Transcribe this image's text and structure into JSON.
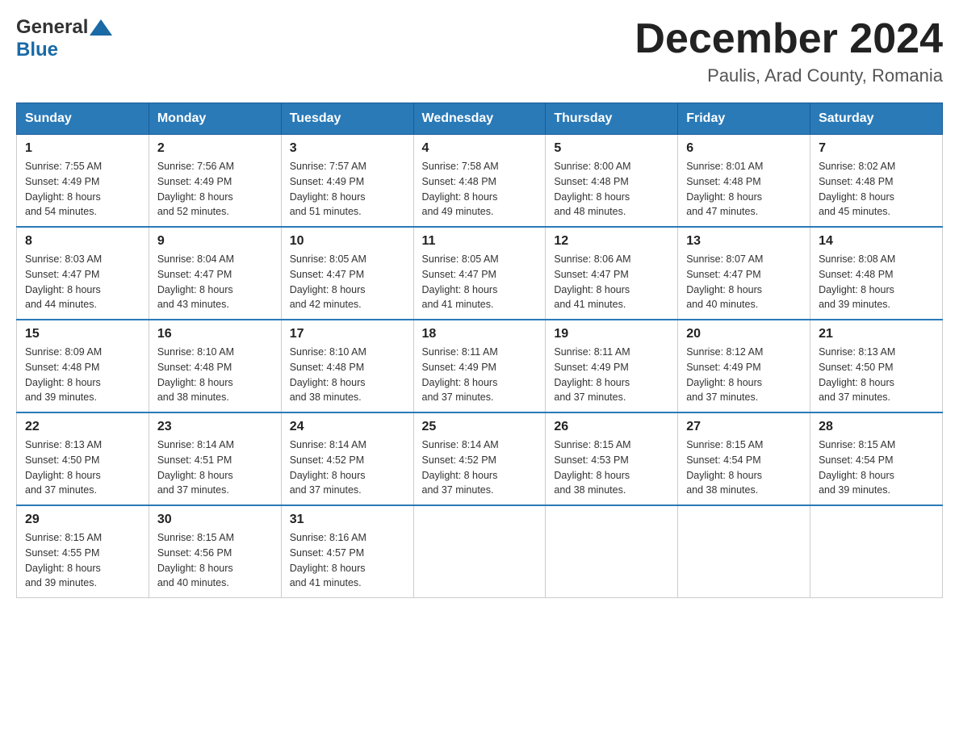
{
  "header": {
    "title": "December 2024",
    "subtitle": "Paulis, Arad County, Romania",
    "logo_general": "General",
    "logo_blue": "Blue"
  },
  "days_of_week": [
    "Sunday",
    "Monday",
    "Tuesday",
    "Wednesday",
    "Thursday",
    "Friday",
    "Saturday"
  ],
  "weeks": [
    {
      "days": [
        {
          "num": "1",
          "sunrise": "7:55 AM",
          "sunset": "4:49 PM",
          "daylight": "8 hours and 54 minutes."
        },
        {
          "num": "2",
          "sunrise": "7:56 AM",
          "sunset": "4:49 PM",
          "daylight": "8 hours and 52 minutes."
        },
        {
          "num": "3",
          "sunrise": "7:57 AM",
          "sunset": "4:49 PM",
          "daylight": "8 hours and 51 minutes."
        },
        {
          "num": "4",
          "sunrise": "7:58 AM",
          "sunset": "4:48 PM",
          "daylight": "8 hours and 49 minutes."
        },
        {
          "num": "5",
          "sunrise": "8:00 AM",
          "sunset": "4:48 PM",
          "daylight": "8 hours and 48 minutes."
        },
        {
          "num": "6",
          "sunrise": "8:01 AM",
          "sunset": "4:48 PM",
          "daylight": "8 hours and 47 minutes."
        },
        {
          "num": "7",
          "sunrise": "8:02 AM",
          "sunset": "4:48 PM",
          "daylight": "8 hours and 45 minutes."
        }
      ]
    },
    {
      "days": [
        {
          "num": "8",
          "sunrise": "8:03 AM",
          "sunset": "4:47 PM",
          "daylight": "8 hours and 44 minutes."
        },
        {
          "num": "9",
          "sunrise": "8:04 AM",
          "sunset": "4:47 PM",
          "daylight": "8 hours and 43 minutes."
        },
        {
          "num": "10",
          "sunrise": "8:05 AM",
          "sunset": "4:47 PM",
          "daylight": "8 hours and 42 minutes."
        },
        {
          "num": "11",
          "sunrise": "8:05 AM",
          "sunset": "4:47 PM",
          "daylight": "8 hours and 41 minutes."
        },
        {
          "num": "12",
          "sunrise": "8:06 AM",
          "sunset": "4:47 PM",
          "daylight": "8 hours and 41 minutes."
        },
        {
          "num": "13",
          "sunrise": "8:07 AM",
          "sunset": "4:47 PM",
          "daylight": "8 hours and 40 minutes."
        },
        {
          "num": "14",
          "sunrise": "8:08 AM",
          "sunset": "4:48 PM",
          "daylight": "8 hours and 39 minutes."
        }
      ]
    },
    {
      "days": [
        {
          "num": "15",
          "sunrise": "8:09 AM",
          "sunset": "4:48 PM",
          "daylight": "8 hours and 39 minutes."
        },
        {
          "num": "16",
          "sunrise": "8:10 AM",
          "sunset": "4:48 PM",
          "daylight": "8 hours and 38 minutes."
        },
        {
          "num": "17",
          "sunrise": "8:10 AM",
          "sunset": "4:48 PM",
          "daylight": "8 hours and 38 minutes."
        },
        {
          "num": "18",
          "sunrise": "8:11 AM",
          "sunset": "4:49 PM",
          "daylight": "8 hours and 37 minutes."
        },
        {
          "num": "19",
          "sunrise": "8:11 AM",
          "sunset": "4:49 PM",
          "daylight": "8 hours and 37 minutes."
        },
        {
          "num": "20",
          "sunrise": "8:12 AM",
          "sunset": "4:49 PM",
          "daylight": "8 hours and 37 minutes."
        },
        {
          "num": "21",
          "sunrise": "8:13 AM",
          "sunset": "4:50 PM",
          "daylight": "8 hours and 37 minutes."
        }
      ]
    },
    {
      "days": [
        {
          "num": "22",
          "sunrise": "8:13 AM",
          "sunset": "4:50 PM",
          "daylight": "8 hours and 37 minutes."
        },
        {
          "num": "23",
          "sunrise": "8:14 AM",
          "sunset": "4:51 PM",
          "daylight": "8 hours and 37 minutes."
        },
        {
          "num": "24",
          "sunrise": "8:14 AM",
          "sunset": "4:52 PM",
          "daylight": "8 hours and 37 minutes."
        },
        {
          "num": "25",
          "sunrise": "8:14 AM",
          "sunset": "4:52 PM",
          "daylight": "8 hours and 37 minutes."
        },
        {
          "num": "26",
          "sunrise": "8:15 AM",
          "sunset": "4:53 PM",
          "daylight": "8 hours and 38 minutes."
        },
        {
          "num": "27",
          "sunrise": "8:15 AM",
          "sunset": "4:54 PM",
          "daylight": "8 hours and 38 minutes."
        },
        {
          "num": "28",
          "sunrise": "8:15 AM",
          "sunset": "4:54 PM",
          "daylight": "8 hours and 39 minutes."
        }
      ]
    },
    {
      "days": [
        {
          "num": "29",
          "sunrise": "8:15 AM",
          "sunset": "4:55 PM",
          "daylight": "8 hours and 39 minutes."
        },
        {
          "num": "30",
          "sunrise": "8:15 AM",
          "sunset": "4:56 PM",
          "daylight": "8 hours and 40 minutes."
        },
        {
          "num": "31",
          "sunrise": "8:16 AM",
          "sunset": "4:57 PM",
          "daylight": "8 hours and 41 minutes."
        },
        null,
        null,
        null,
        null
      ]
    }
  ],
  "labels": {
    "sunrise": "Sunrise:",
    "sunset": "Sunset:",
    "daylight": "Daylight:"
  }
}
